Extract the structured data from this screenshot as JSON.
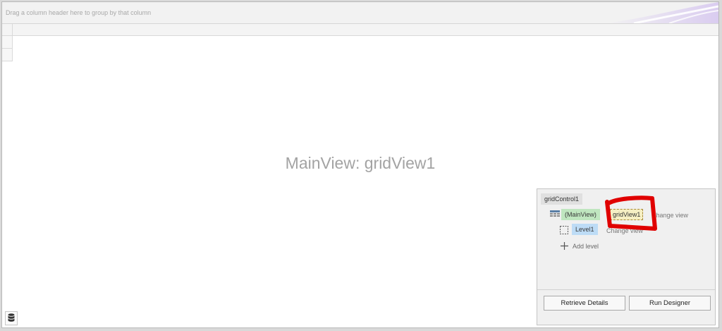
{
  "group_panel": {
    "hint": "Drag a column header here to group by that column"
  },
  "grid": {
    "placeholder": "MainView: gridView1"
  },
  "designer": {
    "control_name": "gridControl1",
    "main_view_label": "(MainView)",
    "grid_view_name": "gridView1",
    "change_view_label": "Change view",
    "level_label": "Level1",
    "level_change_view_label": "Change view",
    "add_level_label": "Add level",
    "retrieve_details_label": "Retrieve Details",
    "run_designer_label": "Run Designer"
  },
  "colors": {
    "main_view_tag": "#bfe6bf",
    "grid_view_tag": "#f6efc3",
    "level_tag": "#bddcf6",
    "annotation": "#e00000"
  },
  "icons": {
    "db": "database-icon",
    "grid_view": "grid-view-icon",
    "level": "level-placeholder-icon",
    "add": "plus-icon"
  }
}
